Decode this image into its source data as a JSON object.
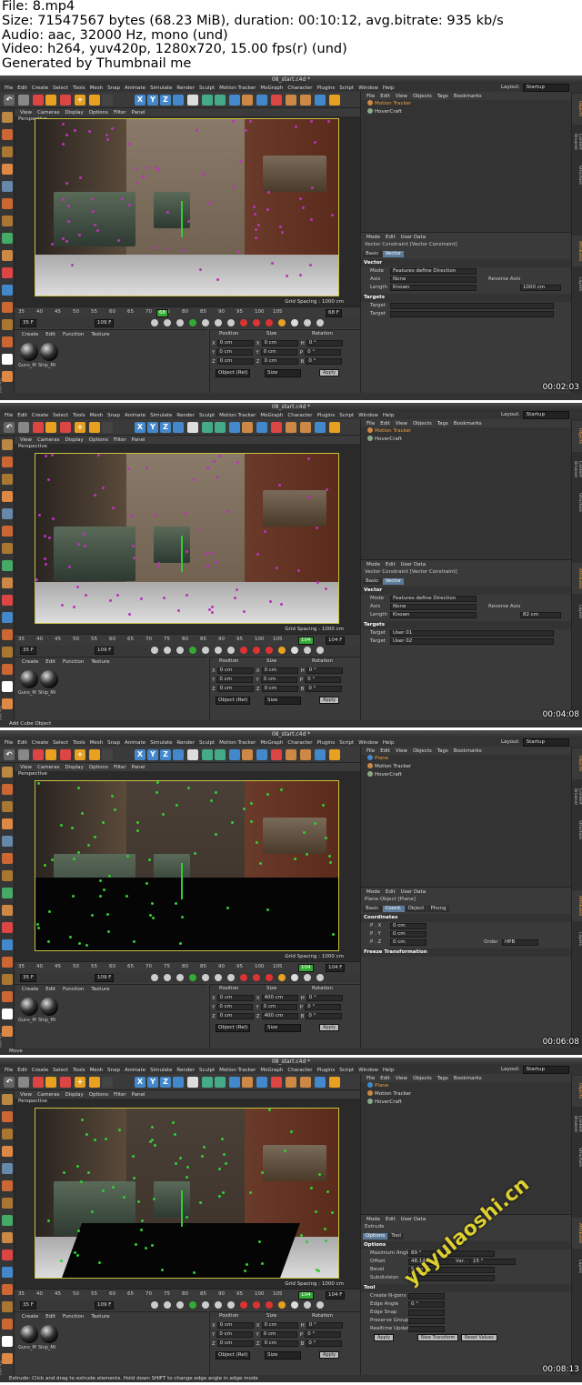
{
  "header": [
    "File: 8.mp4",
    "Size: 71547567 bytes (68.23 MiB), duration: 00:10:12, avg.bitrate: 935 kb/s",
    "Audio: aac, 32000 Hz, mono (und)",
    "Video: h264, yuv420p, 1280x720, 15.00 fps(r) (und)",
    "Generated by Thumbnail me"
  ],
  "window_title": "08_start.c4d *",
  "menu": [
    "File",
    "Edit",
    "Create",
    "Select",
    "Tools",
    "Mesh",
    "Snap",
    "Animate",
    "Simulate",
    "Render",
    "Sculpt",
    "Motion Tracker",
    "MoGraph",
    "Character",
    "Plugins",
    "Script",
    "Window",
    "Help"
  ],
  "layout_label": "Layout:",
  "layout_value": "Startup",
  "viewport_menu": [
    "View",
    "Cameras",
    "Display",
    "Options",
    "Filter",
    "Panel"
  ],
  "viewport_label": "Perspective",
  "grid_spacing": "Grid Spacing : 1000 cm",
  "ticks": [
    "35",
    "40",
    "45",
    "50",
    "55",
    "60",
    "65",
    "70",
    "75",
    "80",
    "85",
    "90",
    "95",
    "100",
    "105"
  ],
  "frame_start": "35 F",
  "material_menu": [
    "Create",
    "Edit",
    "Function",
    "Texture"
  ],
  "materials": [
    "Guns_M",
    "Ship_Mi"
  ],
  "maxon": "MAXON CINEMA 4D",
  "coord_headers": [
    "Position",
    "Size",
    "Rotation"
  ],
  "coord_mode": "Object (Rel)",
  "coord_size_mode": "Size",
  "apply": "Apply",
  "objects_menu": [
    "File",
    "Edit",
    "View",
    "Objects",
    "Tags",
    "Bookmarks"
  ],
  "attr_menu": [
    "Mode",
    "Edit",
    "User Data"
  ],
  "side_tabs": [
    "Objects",
    "Content Browser",
    "Structure"
  ],
  "side_tabs2": [
    "Attributes",
    "Layers"
  ],
  "frames": [
    {
      "time": "00:02:03",
      "current": "68",
      "current_box": "68 F",
      "range_a": "35 F",
      "range_b": "109 F",
      "objects": [
        "Motion Tracker",
        "HoverCraft"
      ],
      "attr_title": "Vector Constraint [Vector Constraint]",
      "attr_tabs": [
        "Basic",
        "Vector"
      ],
      "attr_section": "Vector",
      "rows": [
        [
          "Mode",
          "Features define Direction"
        ],
        [
          "Axis",
          "None"
        ],
        [
          "Length",
          "Known"
        ]
      ],
      "extra_label": "Reverse Axis",
      "length_value": "1000 cm",
      "targets_label": "Targets",
      "targets": [
        [
          "Target",
          ""
        ],
        [
          "Target",
          ""
        ]
      ],
      "coords": [
        [
          "X",
          "0 cm",
          "X",
          "0 cm",
          "H",
          "0 °"
        ],
        [
          "Y",
          "0 cm",
          "Y",
          "0 cm",
          "P",
          "0 °"
        ],
        [
          "Z",
          "0 cm",
          "Z",
          "0 cm",
          "B",
          "0 °"
        ]
      ],
      "status": ""
    },
    {
      "time": "00:04:08",
      "current": "104",
      "current_box": "104 F",
      "range_a": "35 F",
      "range_b": "109 F",
      "objects": [
        "Motion Tracker",
        "HoverCraft"
      ],
      "attr_title": "Vector Constraint [Vector Constraint]",
      "attr_tabs": [
        "Basic",
        "Vector"
      ],
      "attr_section": "Vector",
      "rows": [
        [
          "Mode",
          "Features define Direction"
        ],
        [
          "Axis",
          "None"
        ],
        [
          "Length",
          "Known"
        ]
      ],
      "extra_label": "Reverse Axis",
      "length_value": "82 cm",
      "targets_label": "Targets",
      "targets": [
        [
          "Target",
          "User 01"
        ],
        [
          "Target",
          "User 02"
        ]
      ],
      "coords": [
        [
          "X",
          "0 cm",
          "X",
          "0 cm",
          "H",
          "0 °"
        ],
        [
          "Y",
          "0 cm",
          "Y",
          "0 cm",
          "P",
          "0 °"
        ],
        [
          "Z",
          "0 cm",
          "Z",
          "0 cm",
          "B",
          "0 °"
        ]
      ],
      "status": "Add Cube Object"
    },
    {
      "time": "00:06:08",
      "current": "104",
      "current_box": "104 F",
      "range_a": "35 F",
      "range_b": "109 F",
      "objects": [
        "Plane",
        "Motion Tracker",
        "HoverCraft"
      ],
      "attr_title": "Plane Object [Plane]",
      "attr_tabs": [
        "Basic",
        "Coord.",
        "Object",
        "Phong"
      ],
      "attr_section": "Coordinates",
      "rows": [
        [
          "P . X",
          "0 cm"
        ],
        [
          "P . Y",
          "0 cm"
        ],
        [
          "P . Z",
          "0 cm"
        ]
      ],
      "extra_label": "Order",
      "length_value": "HPB",
      "targets_label": "Freeze Transformation",
      "targets": [],
      "coords": [
        [
          "X",
          "0 cm",
          "X",
          "400 cm",
          "H",
          "0 °"
        ],
        [
          "Y",
          "0 cm",
          "Y",
          "0 cm",
          "P",
          "0 °"
        ],
        [
          "Z",
          "0 cm",
          "Z",
          "400 cm",
          "B",
          "0 °"
        ]
      ],
      "status": "Move"
    },
    {
      "time": "00:08:13",
      "current": "104",
      "current_box": "104 F",
      "range_a": "35 F",
      "range_b": "109 F",
      "objects": [
        "Plane",
        "Motion Tracker",
        "HoverCraft"
      ],
      "attr_title": "Extrude",
      "attr_tabs": [
        "Options",
        "Tool"
      ],
      "attr_section": "Options",
      "rows": [
        [
          "Maximum Angle",
          "89 °"
        ],
        [
          "Offset",
          "48.142 cm"
        ],
        [
          "Bevel",
          "5 cm"
        ],
        [
          "Subdivision",
          "0"
        ]
      ],
      "extra_label": "Var.",
      "length_value": "15 °",
      "targets_label": "Tool",
      "targets": [
        [
          "Create N-gons",
          ""
        ],
        [
          "Edge Angle",
          "0 °"
        ],
        [
          "Edge Snap",
          ""
        ],
        [
          "Preserve Groups",
          ""
        ],
        [
          "Realtime Update",
          ""
        ]
      ],
      "coords": [
        [
          "X",
          "0 cm",
          "X",
          "0 cm",
          "H",
          "0 °"
        ],
        [
          "Y",
          "0 cm",
          "Y",
          "0 cm",
          "P",
          "0 °"
        ],
        [
          "Z",
          "0 cm",
          "Z",
          "0 cm",
          "B",
          "0 °"
        ]
      ],
      "status": "Extrude: Click and drag to extrude elements. Hold down SHIFT to change edge angle in edge mode",
      "buttons": [
        "Apply",
        "New Transform",
        "Reset Values"
      ]
    }
  ],
  "watermark": "yuyulaoshi.cn"
}
